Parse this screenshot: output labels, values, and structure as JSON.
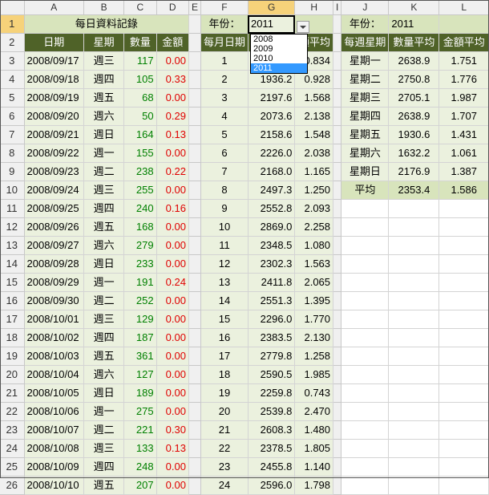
{
  "col_headers": [
    "A",
    "B",
    "C",
    "D",
    "E",
    "F",
    "G",
    "H",
    "I",
    "J",
    "K",
    "L"
  ],
  "row_numbers": [
    "1",
    "2",
    "3",
    "4",
    "5",
    "6",
    "7",
    "8",
    "9",
    "10",
    "11",
    "12",
    "13",
    "14",
    "15",
    "16",
    "17",
    "18",
    "19",
    "20",
    "21",
    "22",
    "23",
    "24",
    "25",
    "26"
  ],
  "daily": {
    "title": "每日資料記錄",
    "headers": [
      "日期",
      "星期",
      "數量",
      "金額"
    ],
    "rows": [
      [
        "2008/09/17",
        "週三",
        "117",
        "0.00"
      ],
      [
        "2008/09/18",
        "週四",
        "105",
        "0.33"
      ],
      [
        "2008/09/19",
        "週五",
        "68",
        "0.00"
      ],
      [
        "2008/09/20",
        "週六",
        "50",
        "0.29"
      ],
      [
        "2008/09/21",
        "週日",
        "164",
        "0.13"
      ],
      [
        "2008/09/22",
        "週一",
        "155",
        "0.00"
      ],
      [
        "2008/09/23",
        "週二",
        "238",
        "0.22"
      ],
      [
        "2008/09/24",
        "週三",
        "255",
        "0.00"
      ],
      [
        "2008/09/25",
        "週四",
        "240",
        "0.16"
      ],
      [
        "2008/09/26",
        "週五",
        "168",
        "0.00"
      ],
      [
        "2008/09/27",
        "週六",
        "279",
        "0.00"
      ],
      [
        "2008/09/28",
        "週日",
        "233",
        "0.00"
      ],
      [
        "2008/09/29",
        "週一",
        "191",
        "0.24"
      ],
      [
        "2008/09/30",
        "週二",
        "252",
        "0.00"
      ],
      [
        "2008/10/01",
        "週三",
        "129",
        "0.00"
      ],
      [
        "2008/10/02",
        "週四",
        "187",
        "0.00"
      ],
      [
        "2008/10/03",
        "週五",
        "361",
        "0.00"
      ],
      [
        "2008/10/04",
        "週六",
        "127",
        "0.00"
      ],
      [
        "2008/10/05",
        "週日",
        "189",
        "0.00"
      ],
      [
        "2008/10/06",
        "週一",
        "275",
        "0.00"
      ],
      [
        "2008/10/07",
        "週二",
        "221",
        "0.30"
      ],
      [
        "2008/10/08",
        "週三",
        "133",
        "0.13"
      ],
      [
        "2008/10/09",
        "週四",
        "248",
        "0.00"
      ],
      [
        "2008/10/10",
        "週五",
        "207",
        "0.00"
      ]
    ]
  },
  "monthly": {
    "year_label": "年份：",
    "year_value": "2011",
    "headers": [
      "每月日期",
      "",
      "額平均"
    ],
    "rows": [
      [
        "1",
        "",
        "0.834"
      ],
      [
        "2",
        "1936.2",
        "0.928"
      ],
      [
        "3",
        "2197.6",
        "1.568"
      ],
      [
        "4",
        "2073.6",
        "2.138"
      ],
      [
        "5",
        "2158.6",
        "1.548"
      ],
      [
        "6",
        "2226.0",
        "2.038"
      ],
      [
        "7",
        "2168.0",
        "1.165"
      ],
      [
        "8",
        "2497.3",
        "1.250"
      ],
      [
        "9",
        "2552.8",
        "2.093"
      ],
      [
        "10",
        "2869.0",
        "2.258"
      ],
      [
        "11",
        "2348.5",
        "1.080"
      ],
      [
        "12",
        "2302.3",
        "1.563"
      ],
      [
        "13",
        "2411.8",
        "2.065"
      ],
      [
        "14",
        "2551.3",
        "1.395"
      ],
      [
        "15",
        "2296.0",
        "1.770"
      ],
      [
        "16",
        "2383.5",
        "2.130"
      ],
      [
        "17",
        "2779.8",
        "1.258"
      ],
      [
        "18",
        "2590.5",
        "1.985"
      ],
      [
        "19",
        "2259.8",
        "0.743"
      ],
      [
        "20",
        "2539.8",
        "2.470"
      ],
      [
        "21",
        "2608.3",
        "1.480"
      ],
      [
        "22",
        "2378.5",
        "1.805"
      ],
      [
        "23",
        "2455.8",
        "1.140"
      ],
      [
        "24",
        "2596.0",
        "1.798"
      ]
    ],
    "dropdown_options": [
      "2008",
      "2009",
      "2010",
      "2011"
    ],
    "dropdown_selected": "2011"
  },
  "weekly": {
    "year_label": "年份：",
    "year_value": "2011",
    "headers": [
      "每週星期",
      "數量平均",
      "金額平均"
    ],
    "rows": [
      [
        "星期一",
        "2638.9",
        "1.751"
      ],
      [
        "星期二",
        "2750.8",
        "1.776"
      ],
      [
        "星期三",
        "2705.1",
        "1.987"
      ],
      [
        "星期四",
        "2638.9",
        "1.707"
      ],
      [
        "星期五",
        "1930.6",
        "1.431"
      ],
      [
        "星期六",
        "1632.2",
        "1.061"
      ],
      [
        "星期日",
        "2176.9",
        "1.387"
      ]
    ],
    "avg_label": "平均",
    "avg_qty": "2353.4",
    "avg_amt": "1.586"
  },
  "colors": {
    "title_bg": "#d8e4bc",
    "header_bg": "#4f6228",
    "band_bg": "#ebf1de",
    "qty_green": "#008000",
    "amt_red": "#e00000",
    "selected_header": "#f6d27a",
    "dropdown_highlight": "#3399ff"
  }
}
